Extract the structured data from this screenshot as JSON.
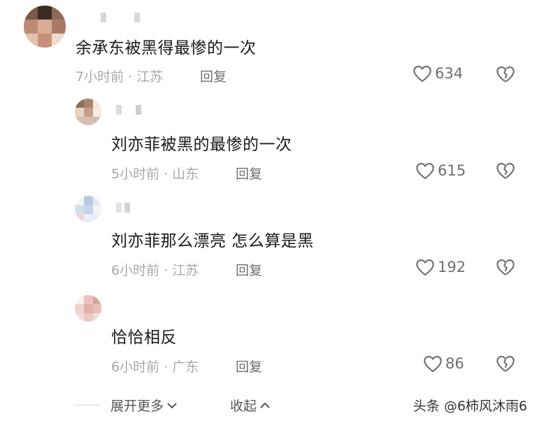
{
  "comments": [
    {
      "text": "余承东被黑得最惨的一次",
      "time": "7小时前",
      "location": "江苏",
      "reply_label": "回复",
      "likes": "634"
    },
    {
      "text": "刘亦菲被黑的最惨的一次",
      "time": "5小时前",
      "location": "山东",
      "reply_label": "回复",
      "likes": "615"
    },
    {
      "text": "刘亦菲那么漂亮 怎么算是黑",
      "time": "6小时前",
      "location": "江苏",
      "reply_label": "回复",
      "likes": "192"
    },
    {
      "text": "恰恰相反",
      "time": "6小时前",
      "location": "广东",
      "reply_label": "回复",
      "likes": "86"
    }
  ],
  "meta_separator": "·",
  "footer": {
    "expand_label": "展开更多",
    "collapse_label": "收起"
  },
  "watermark": "头条 @6柿风沐雨6",
  "colors": {
    "text": "#1a1a1a",
    "meta": "#a7a7a7",
    "icon": "#6e6e6e"
  },
  "icons": [
    "heart-icon",
    "broken-heart-icon",
    "chevron-down-icon",
    "chevron-up-icon"
  ]
}
